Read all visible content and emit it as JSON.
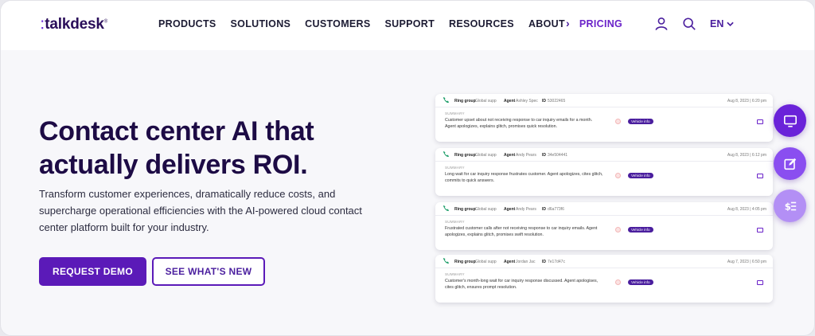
{
  "header": {
    "logo": "talkdesk",
    "logo_mark": "®",
    "menu": [
      {
        "label": "PRODUCTS"
      },
      {
        "label": "SOLUTIONS"
      },
      {
        "label": "CUSTOMERS"
      },
      {
        "label": "SUPPORT"
      },
      {
        "label": "RESOURCES"
      },
      {
        "label": "ABOUT"
      },
      {
        "label": "PRICING"
      }
    ],
    "language": "EN"
  },
  "hero": {
    "title_line1": "Contact center AI that",
    "title_line2": "actually delivers ROI.",
    "subtitle": "Transform customer experiences, dramatically reduce costs, and supercharge operational efficiencies with the AI-powered cloud contact center platform built for your industry.",
    "primary_button": "REQUEST DEMO",
    "secondary_button": "SEE WHAT'S NEW"
  },
  "cards": [
    {
      "ring_group_label": "Ring group",
      "ring_group": "Global supp",
      "agent_label": "Agent",
      "agent": "Ashley Spec",
      "id_label": "ID",
      "id": "53022465",
      "date": "Aug 8, 2023 | 6:20 pm",
      "summary_label": "SUMMARY",
      "summary": "Customer upset about not receiving response to car inquiry emails for a month. Agent apologizes, explains glitch, promises quick resolution.",
      "tag": "Vehicle info"
    },
    {
      "ring_group_label": "Ring group",
      "ring_group": "Global supp",
      "agent_label": "Agent",
      "agent": "Andy Pears",
      "id_label": "ID",
      "id": "34e504441",
      "date": "Aug 8, 2023 | 6:12 pm",
      "summary_label": "SUMMARY",
      "summary": "Long wait for car inquiry response frustrates customer. Agent apologizes, cites glitch, commits to quick answers.",
      "tag": "Vehicle info"
    },
    {
      "ring_group_label": "Ring group",
      "ring_group": "Global supp",
      "agent_label": "Agent",
      "agent": "Andy Pears",
      "id_label": "ID",
      "id": "d6a773f6",
      "date": "Aug 8, 2023 | 4:05 pm",
      "summary_label": "SUMMARY",
      "summary": "Frustrated customer calls after not receiving response to car inquiry emails. Agent apologizes, explains glitch, promises swift resolution.",
      "tag": "Vehicle info"
    },
    {
      "ring_group_label": "Ring group",
      "ring_group": "Global supp",
      "agent_label": "Agent",
      "agent": "Jordan Jac",
      "id_label": "ID",
      "id": "7e17d47c",
      "date": "Aug 7, 2023 | 6:50 pm",
      "summary_label": "SUMMARY",
      "summary": "Customer's month-long wait for car inquiry response discussed. Agent apologises, cites glitch, ensures prompt resolution.",
      "tag": "Vehicle info"
    }
  ],
  "fab_icons": [
    "monitor-icon",
    "edit-icon",
    "dollar-list-icon"
  ],
  "colors": {
    "brand": "#5b1ab8",
    "title": "#1d0b45",
    "accent": "#6a22c9"
  }
}
